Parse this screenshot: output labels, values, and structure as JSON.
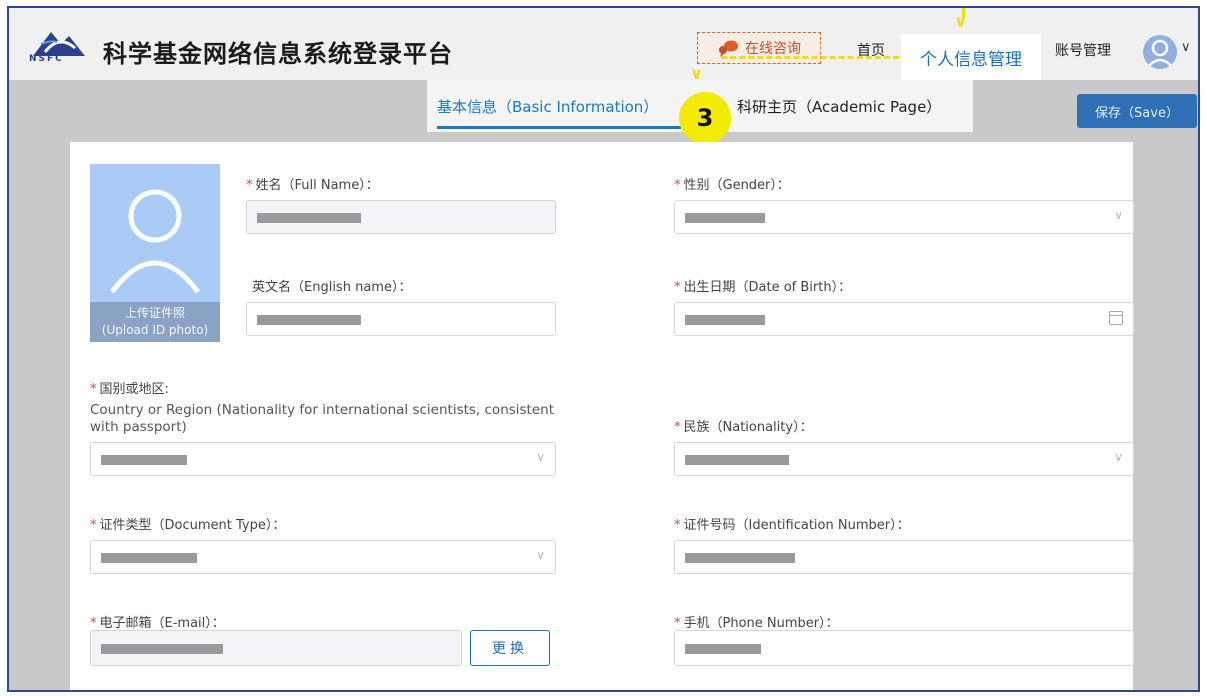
{
  "header": {
    "logo_text": "NSFC",
    "site_title": "科学基金网络信息系统登录平台",
    "consult_label": "在线咨询",
    "nav": {
      "home": "首页",
      "profile": "个人信息管理",
      "account": "账号管理"
    }
  },
  "tabs": {
    "basic": "基本信息（Basic Information）",
    "academic": "科研主页（Academic Page）",
    "save": "保存（Save）"
  },
  "annotation": {
    "step_number": "3",
    "highlight_color": "#f2ea00"
  },
  "photo": {
    "upload_cn": "上传证件照",
    "upload_en": "(Upload ID photo)"
  },
  "form": {
    "full_name": {
      "label": "姓名（Full Name）：",
      "required": true
    },
    "gender": {
      "label": "性别（Gender）：",
      "required": true
    },
    "english_name": {
      "label": "英文名（English name）：",
      "required": false
    },
    "birth_date": {
      "label": "出生日期（Date of Birth）：",
      "required": true
    },
    "country": {
      "label": "国别或地区:",
      "required": true,
      "note": "Country or Region (Nationality for international scientists, consistent with passport)"
    },
    "ethnicity": {
      "label": "民族（Nationality）：",
      "required": true
    },
    "doc_type": {
      "label": "证件类型（Document Type）：",
      "required": true
    },
    "id_number": {
      "label": "证件号码（Identification Number）：",
      "required": true
    },
    "email": {
      "label": "电子邮箱（E-mail）：",
      "required": true
    },
    "phone": {
      "label": "手机（Phone Number）：",
      "required": true
    },
    "change_button": "更换"
  },
  "colors": {
    "accent": "#1e78c8",
    "required_mark": "#e0473a",
    "save_button": "#2f6fb6",
    "frame_border": "#2e4a8f"
  },
  "icons": [
    "nsfc-logo-icon",
    "chat-bubble-icon",
    "user-avatar-icon",
    "chevron-down-icon",
    "calendar-icon",
    "user-silhouette-icon"
  ]
}
